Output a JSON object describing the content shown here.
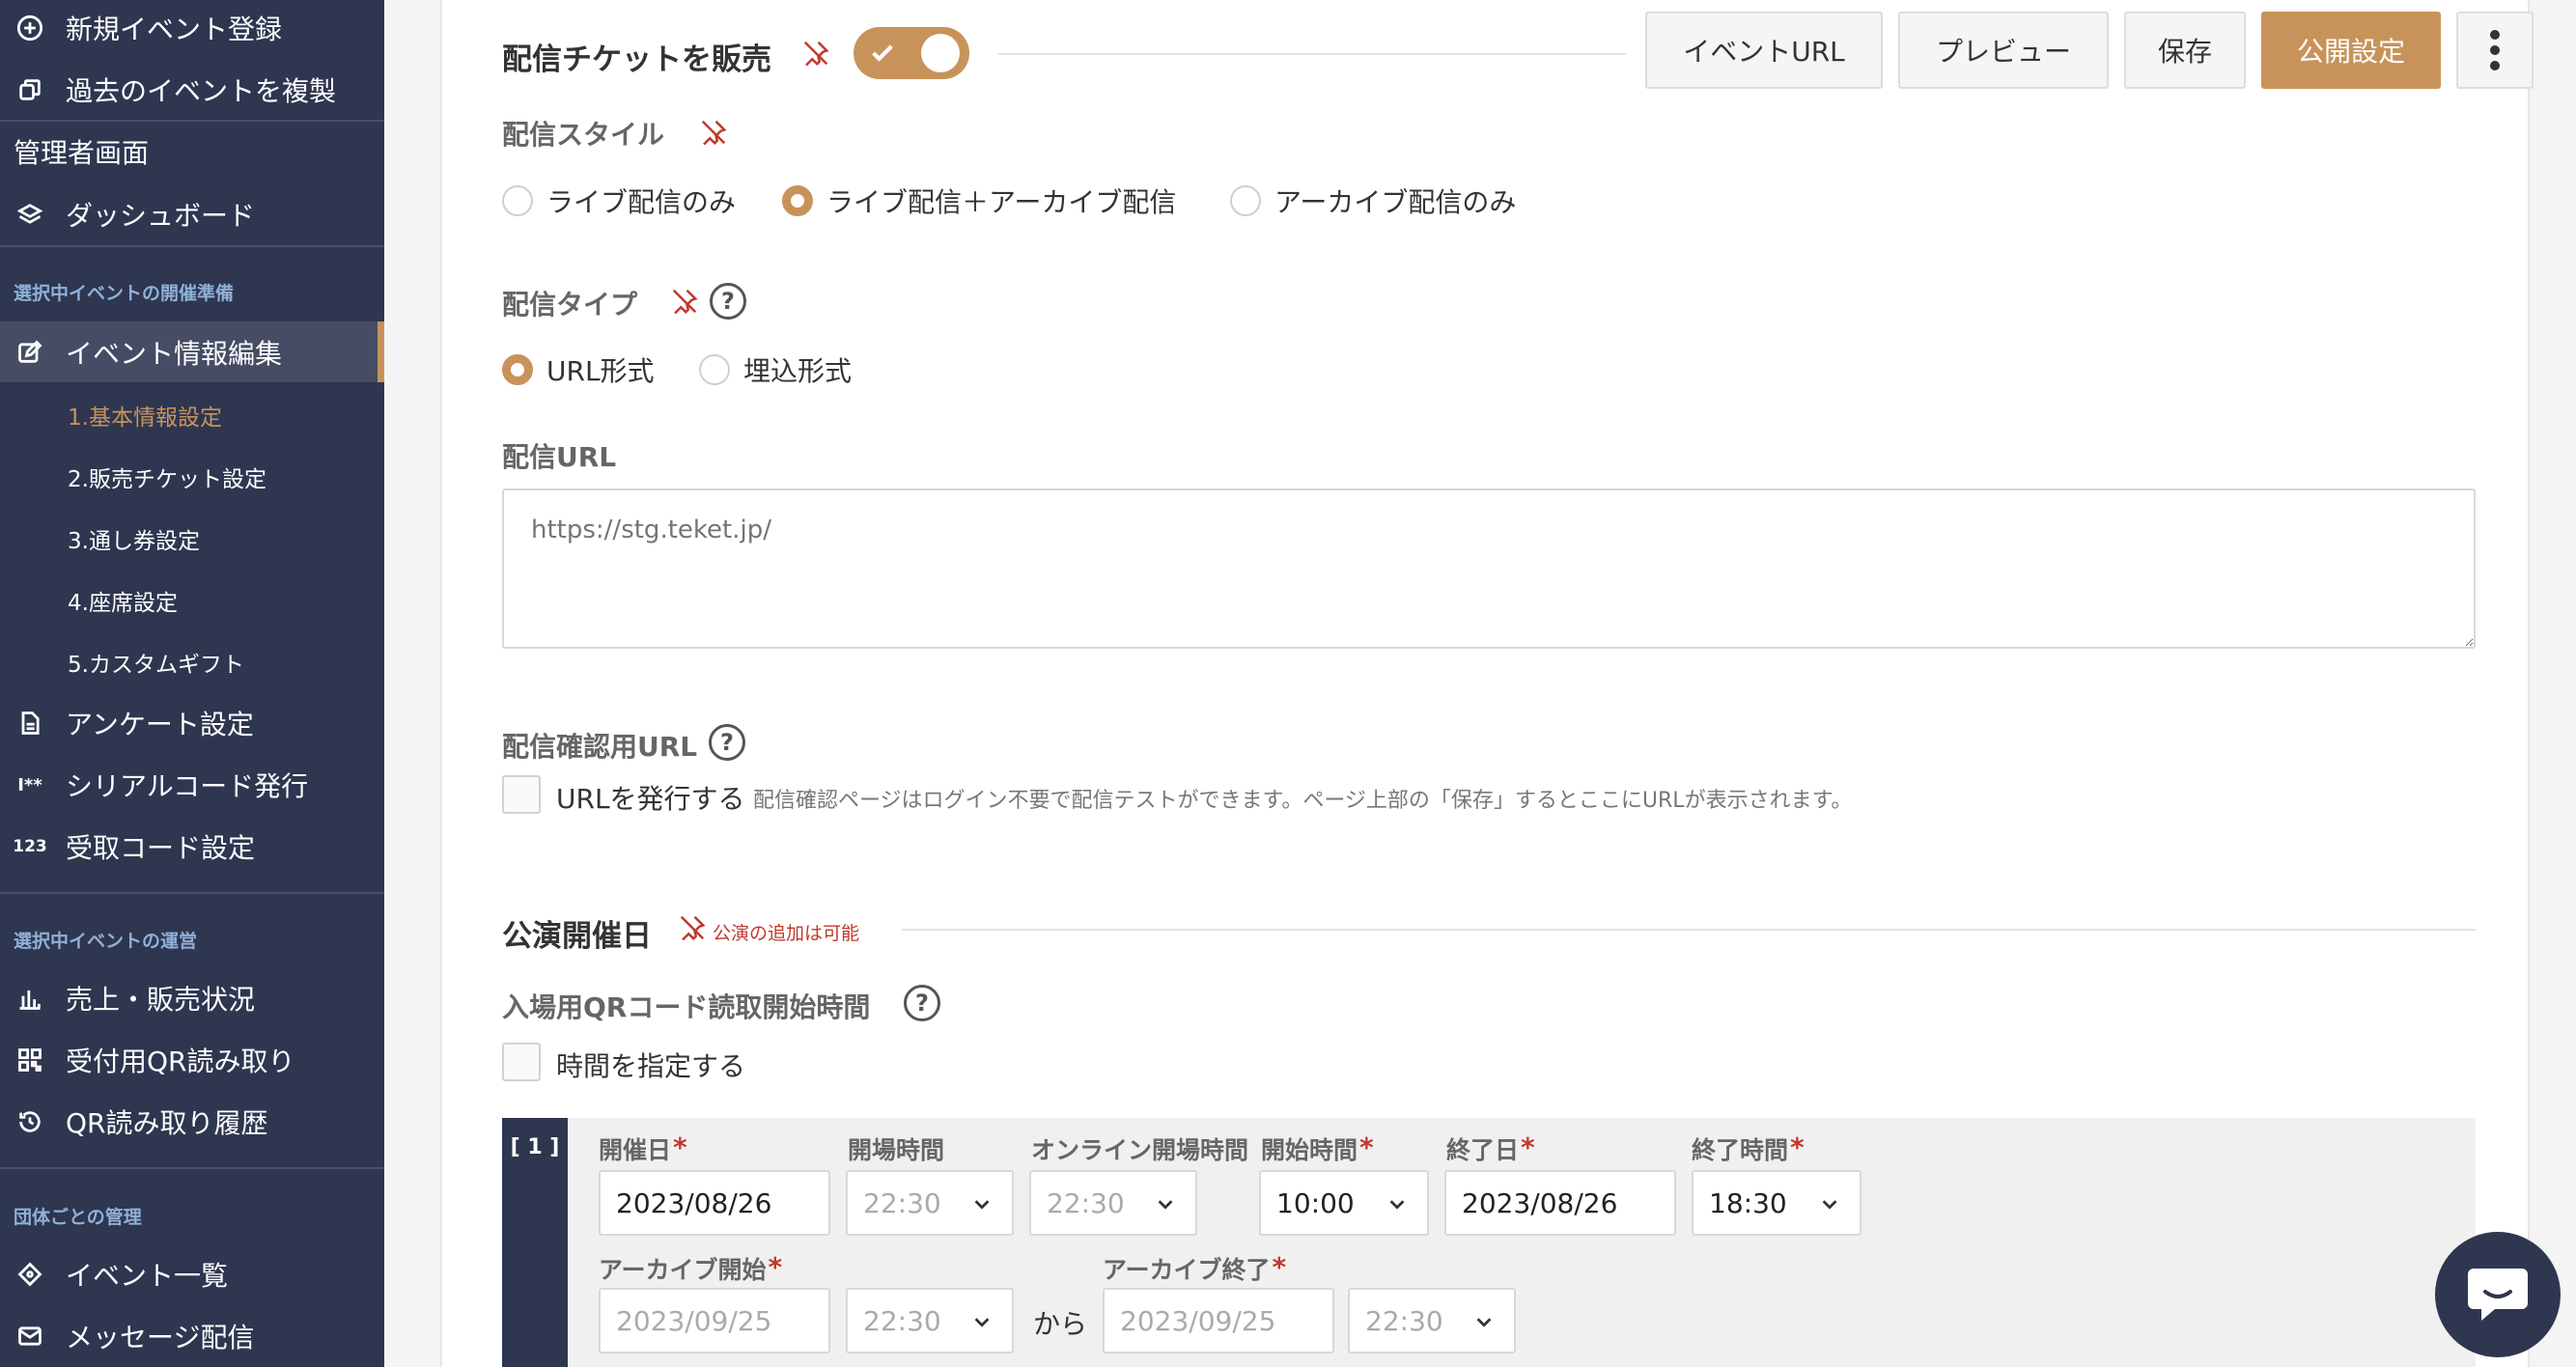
{
  "sidebar": {
    "top_items": [
      {
        "label": "新規イベント登録",
        "icon": "plus-circle-icon"
      },
      {
        "label": "過去のイベントを複製",
        "icon": "copy-icon"
      }
    ],
    "admin_label": "管理者画面",
    "dashboard_label": "ダッシュボード",
    "section_prepare": "選択中イベントの開催準備",
    "event_edit_label": "イベント情報編集",
    "subitems": [
      "1.基本情報設定",
      "2.販売チケット設定",
      "3.通し券設定",
      "4.座席設定",
      "5.カスタムギフト"
    ],
    "prepare_items": [
      {
        "label": "アンケート設定",
        "icon": "document-icon"
      },
      {
        "label": "シリアルコード発行",
        "icon": "serial-code-icon"
      },
      {
        "label": "受取コード設定",
        "icon": "123-icon"
      }
    ],
    "section_operate": "選択中イベントの運営",
    "operate_items": [
      {
        "label": "売上・販売状況",
        "icon": "bar-chart-icon"
      },
      {
        "label": "受付用QR読み取り",
        "icon": "qr-icon"
      },
      {
        "label": "QR読み取り履歴",
        "icon": "history-icon"
      }
    ],
    "section_org": "団体ごとの管理",
    "org_items": [
      {
        "label": "イベント一覧",
        "icon": "ticket-icon"
      },
      {
        "label": "メッセージ配信",
        "icon": "mail-icon"
      }
    ]
  },
  "toolbar": {
    "event_url": "イベントURL",
    "preview": "プレビュー",
    "save": "保存",
    "publish": "公開設定"
  },
  "streaming": {
    "title": "配信チケットを販売",
    "toggle_on": true,
    "style_label": "配信スタイル",
    "style_options": [
      "ライブ配信のみ",
      "ライブ配信＋アーカイブ配信",
      "アーカイブ配信のみ"
    ],
    "style_selected": "ライブ配信＋アーカイブ配信",
    "type_label": "配信タイプ",
    "type_options": [
      "URL形式",
      "埋込形式"
    ],
    "type_selected": "URL形式",
    "url_label": "配信URL",
    "url_placeholder": "https://stg.teket.jp/",
    "confirm_label": "配信確認用URL",
    "confirm_checkbox": "URLを発行する",
    "confirm_note": "配信確認ページはログイン不要で配信テストができます。ページ上部の「保存」するとここにURLが表示されます。"
  },
  "performance": {
    "title": "公演開催日",
    "note": "公演の追加は可能",
    "qr_label": "入場用QRコード読取開始時間",
    "qr_checkbox": "時間を指定する",
    "row_index": "[ 1 ]",
    "fields": {
      "date_label": "開催日",
      "date_value": "2023/08/26",
      "open_label": "開場時間",
      "open_value": "22:30",
      "online_open_label": "オンライン開場時間",
      "online_open_value": "22:30",
      "start_label": "開始時間",
      "start_value": "10:00",
      "end_date_label": "終了日",
      "end_date_value": "2023/08/26",
      "end_time_label": "終了時間",
      "end_time_value": "18:30",
      "archive_start_label": "アーカイブ開始",
      "archive_start_date": "2023/09/25",
      "archive_start_time": "22:30",
      "kara": "から",
      "archive_end_label": "アーカイブ終了",
      "archive_end_date": "2023/09/25",
      "archive_end_time": "22:30"
    }
  },
  "colors": {
    "accent": "#c8935a",
    "sidebar": "#2e3650",
    "required": "#c0392b"
  }
}
